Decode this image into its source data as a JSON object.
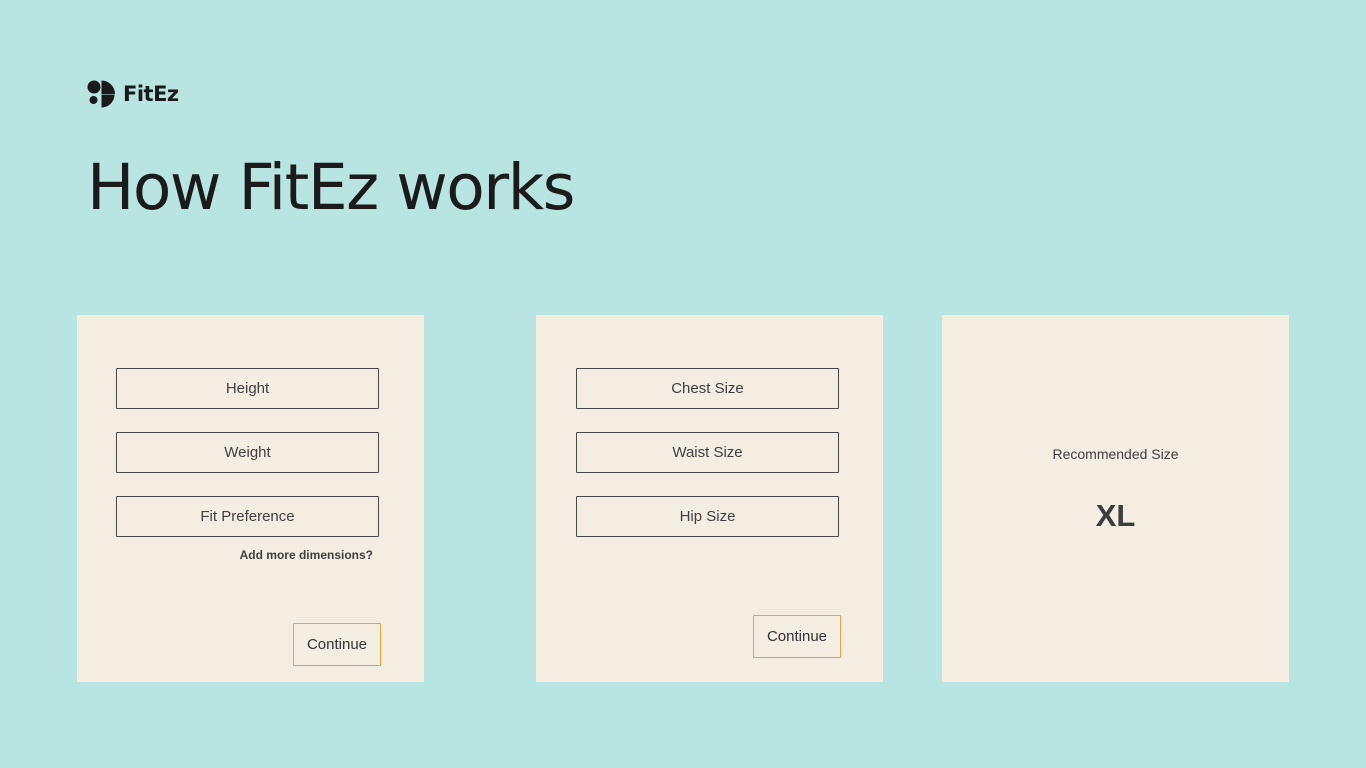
{
  "colors": {
    "background": "#b8e4e1",
    "card": "#f3ede2",
    "accent": "#f0a03a",
    "text": "#1b1b1b"
  },
  "brand": {
    "name": "FitEz",
    "icon": "fitez-logo-icon"
  },
  "page": {
    "title": "How FitEz works"
  },
  "step1": {
    "fields": [
      "Height",
      "Weight",
      "Fit Preference"
    ],
    "add_more_label": "Add more dimensions?",
    "continue_label": "Continue"
  },
  "step2": {
    "fields": [
      "Chest Size",
      "Waist Size",
      "Hip Size"
    ],
    "continue_label": "Continue"
  },
  "step3": {
    "label": "Recommended Size",
    "value": "XL"
  }
}
